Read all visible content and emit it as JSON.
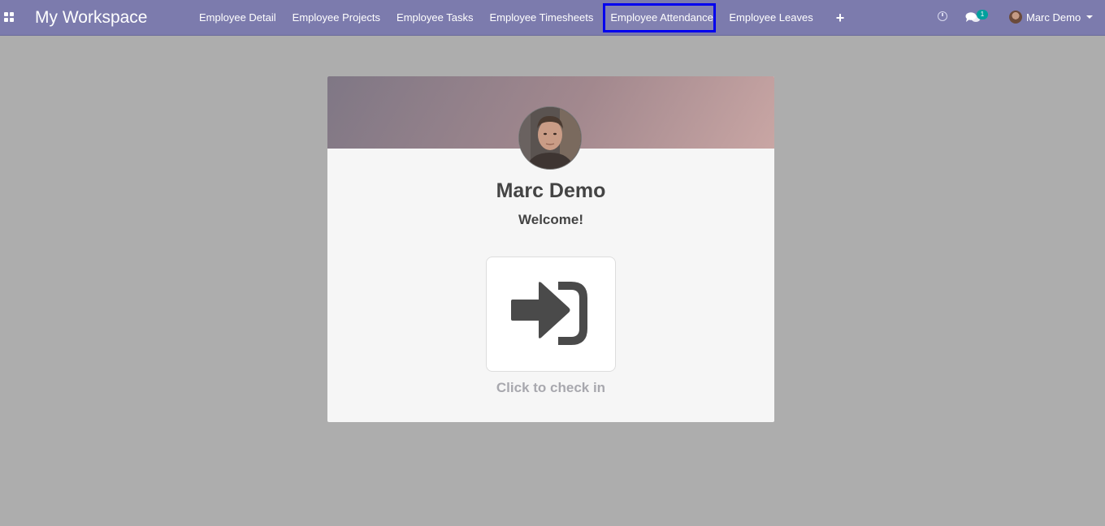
{
  "navbar": {
    "brand": "My Workspace",
    "menu": [
      {
        "label": "Employee Detail",
        "active": false
      },
      {
        "label": "Employee Projects",
        "active": false
      },
      {
        "label": "Employee Tasks",
        "active": false
      },
      {
        "label": "Employee Timesheets",
        "active": false
      },
      {
        "label": "Employee Attendance",
        "active": true
      },
      {
        "label": "Employee Leaves",
        "active": false
      }
    ],
    "add_label": "+",
    "chat_badge_count": "1",
    "user_name": "Marc Demo"
  },
  "attendance": {
    "employee_name": "Marc Demo",
    "greeting": "Welcome!",
    "checkin_label": "Click to check in"
  },
  "colors": {
    "navbar_bg": "#7c7bad",
    "active_outline": "#0000ee",
    "badge": "#00a09d",
    "page_bg": "#adadad"
  }
}
